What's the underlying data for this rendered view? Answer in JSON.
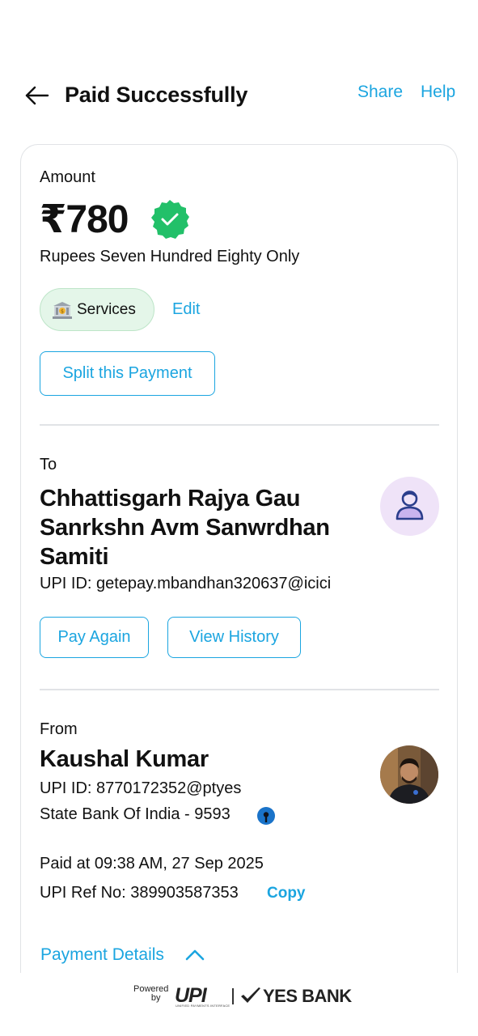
{
  "header": {
    "title": "Paid Successfully",
    "share_label": "Share",
    "help_label": "Help"
  },
  "amount_section": {
    "label": "Amount",
    "amount": "₹780",
    "amount_in_words": "Rupees Seven Hundred Eighty Only",
    "category_label": "Services",
    "edit_label": "Edit",
    "split_label": "Split this Payment"
  },
  "to_section": {
    "label": "To",
    "payee_name": "Chhattisgarh Rajya Gau Sanrkshn Avm Sanwrdhan Samiti",
    "upi_id": "UPI ID: getepay.mbandhan320637@icici",
    "pay_again_label": "Pay Again",
    "view_history_label": "View History"
  },
  "from_section": {
    "label": "From",
    "payer_name": "Kaushal Kumar",
    "upi_id": "UPI ID: 8770172352@ptyes",
    "bank": "State Bank Of India - 9593",
    "paid_at": "Paid at 09:38 AM, 27 Sep 2025",
    "upi_ref": "UPI Ref No: 389903587353",
    "copy_label": "Copy",
    "payment_details_label": "Payment Details"
  },
  "footer": {
    "powered_line1": "Powered",
    "powered_line2": "by",
    "upi_logo": "UPI",
    "upi_sub": "UNIFIED PAYMENTS INTERFACE",
    "bank_name": "YES BANK"
  },
  "colors": {
    "accent": "#1ba5e0",
    "success": "#22c069",
    "chip_bg": "#e4f6e9",
    "avatar_bg": "#efe3f8"
  },
  "icons": {
    "back": "arrow-left-icon",
    "verified": "verified-badge-icon",
    "category": "bank-building-icon",
    "payee_avatar": "person-icon",
    "bank": "sbi-logo-icon",
    "payment_details": "chevron-up-icon"
  }
}
